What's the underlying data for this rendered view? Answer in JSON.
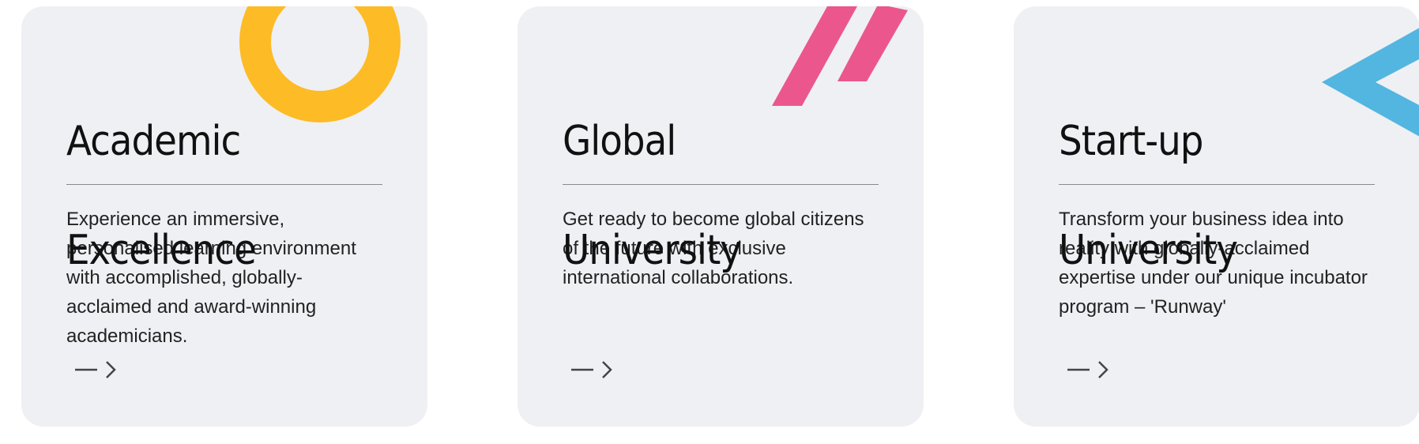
{
  "cards": [
    {
      "title_line1": "Academic",
      "title_line2": "Excellence",
      "description": "Experience an immersive, personalised learning environment with accomplished, globally-acclaimed and award-winning academicians.",
      "decoration": "yellow-ring-icon",
      "accent": "#fdbb25"
    },
    {
      "title_line1": "Global",
      "title_line2": "University",
      "description": "Get ready to become global citizens of the future with exclusive international collaborations.",
      "decoration": "pink-slashes-icon",
      "accent": "#eb578d"
    },
    {
      "title_line1": "Start-up",
      "title_line2": "University",
      "description": "Transform your business idea into reality with globally-acclaimed expertise under our unique incubator program – 'Runway'",
      "decoration": "blue-chevron-icon",
      "accent": "#53b6e0"
    }
  ],
  "colors": {
    "card_background": "#eff0f4",
    "text": "#111111",
    "arrow": "#444444"
  }
}
